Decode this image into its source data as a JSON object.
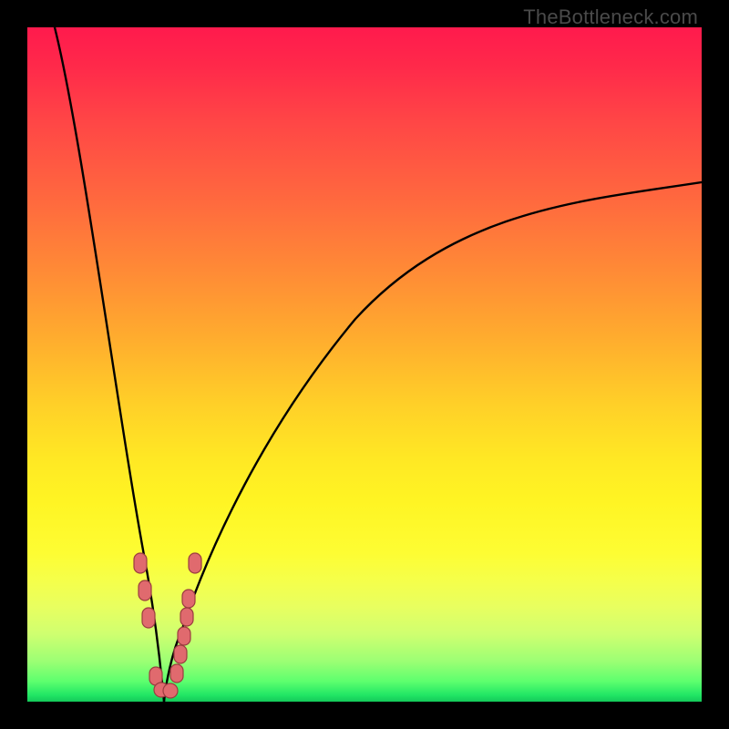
{
  "watermark": "TheBottleneck.com",
  "colors": {
    "frame": "#000000",
    "gradient_top": "#ff1a4d",
    "gradient_bottom": "#14c95a",
    "curve": "#000000",
    "dot_fill": "#e06a6e",
    "dot_stroke": "#9b3d40"
  },
  "chart_data": {
    "type": "line",
    "title": "",
    "xlabel": "",
    "ylabel": "",
    "xlim": [
      0,
      100
    ],
    "ylim": [
      0,
      100
    ],
    "grid": false,
    "legend": false,
    "annotations": [],
    "note": "Axes are unlabeled in the source image; values are fractional positions estimated from pixel coordinates. y is bottleneck-percentage-like: 0 at bottom (green / good), 100 at top (red / severe).",
    "series": [
      {
        "name": "left-branch",
        "x": [
          4.1,
          5.4,
          6.8,
          8.1,
          9.5,
          10.8,
          12.2,
          13.5,
          14.9,
          16.2,
          17.6,
          18.1,
          18.9,
          20.0
        ],
        "y": [
          100.0,
          89.2,
          78.0,
          67.0,
          56.1,
          45.5,
          35.3,
          25.7,
          17.0,
          9.7,
          4.1,
          2.7,
          1.1,
          0.0
        ]
      },
      {
        "name": "right-branch",
        "x": [
          20.0,
          21.6,
          23.0,
          25.7,
          28.4,
          32.4,
          36.5,
          41.9,
          47.3,
          54.1,
          60.8,
          68.9,
          77.0,
          86.5,
          95.9,
          100.0
        ],
        "y": [
          0.0,
          2.0,
          4.7,
          10.8,
          17.8,
          26.6,
          34.1,
          42.2,
          48.6,
          55.1,
          60.1,
          65.2,
          69.3,
          73.0,
          75.9,
          77.0
        ]
      }
    ],
    "markers": {
      "name": "highlighted-points",
      "shape": "rounded-capsule",
      "x": [
        16.6,
        17.2,
        17.8,
        18.9,
        19.6,
        20.9,
        22.0,
        22.6,
        23.0,
        23.4,
        23.6,
        24.7
      ],
      "y": [
        20.9,
        16.9,
        12.8,
        4.1,
        2.0,
        2.0,
        4.7,
        7.4,
        10.1,
        12.8,
        15.5,
        20.9
      ]
    }
  }
}
